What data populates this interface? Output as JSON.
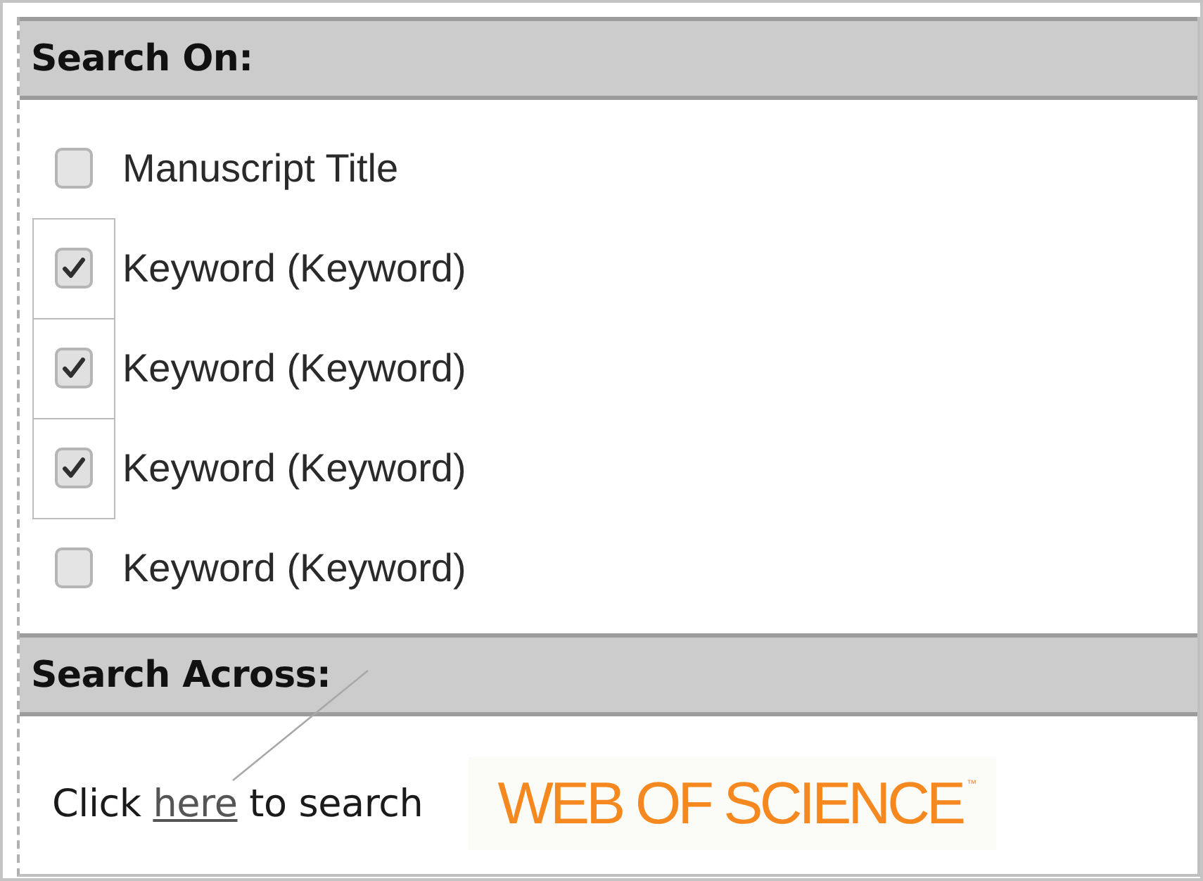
{
  "search_on": {
    "title": "Search On:",
    "options": [
      {
        "label": "Manuscript Title",
        "checked": false,
        "outlined": false
      },
      {
        "label": "Keyword (Keyword)",
        "checked": true,
        "outlined": true
      },
      {
        "label": "Keyword (Keyword)",
        "checked": true,
        "outlined": true
      },
      {
        "label": "Keyword (Keyword)",
        "checked": true,
        "outlined": true
      },
      {
        "label": "Keyword (Keyword)",
        "checked": false,
        "outlined": false
      }
    ]
  },
  "search_across": {
    "title": "Search Across:",
    "text_before": "Click",
    "link": "here",
    "text_after": "to search",
    "logo": "WEB OF SCIENCE$^{™}$"
  }
}
